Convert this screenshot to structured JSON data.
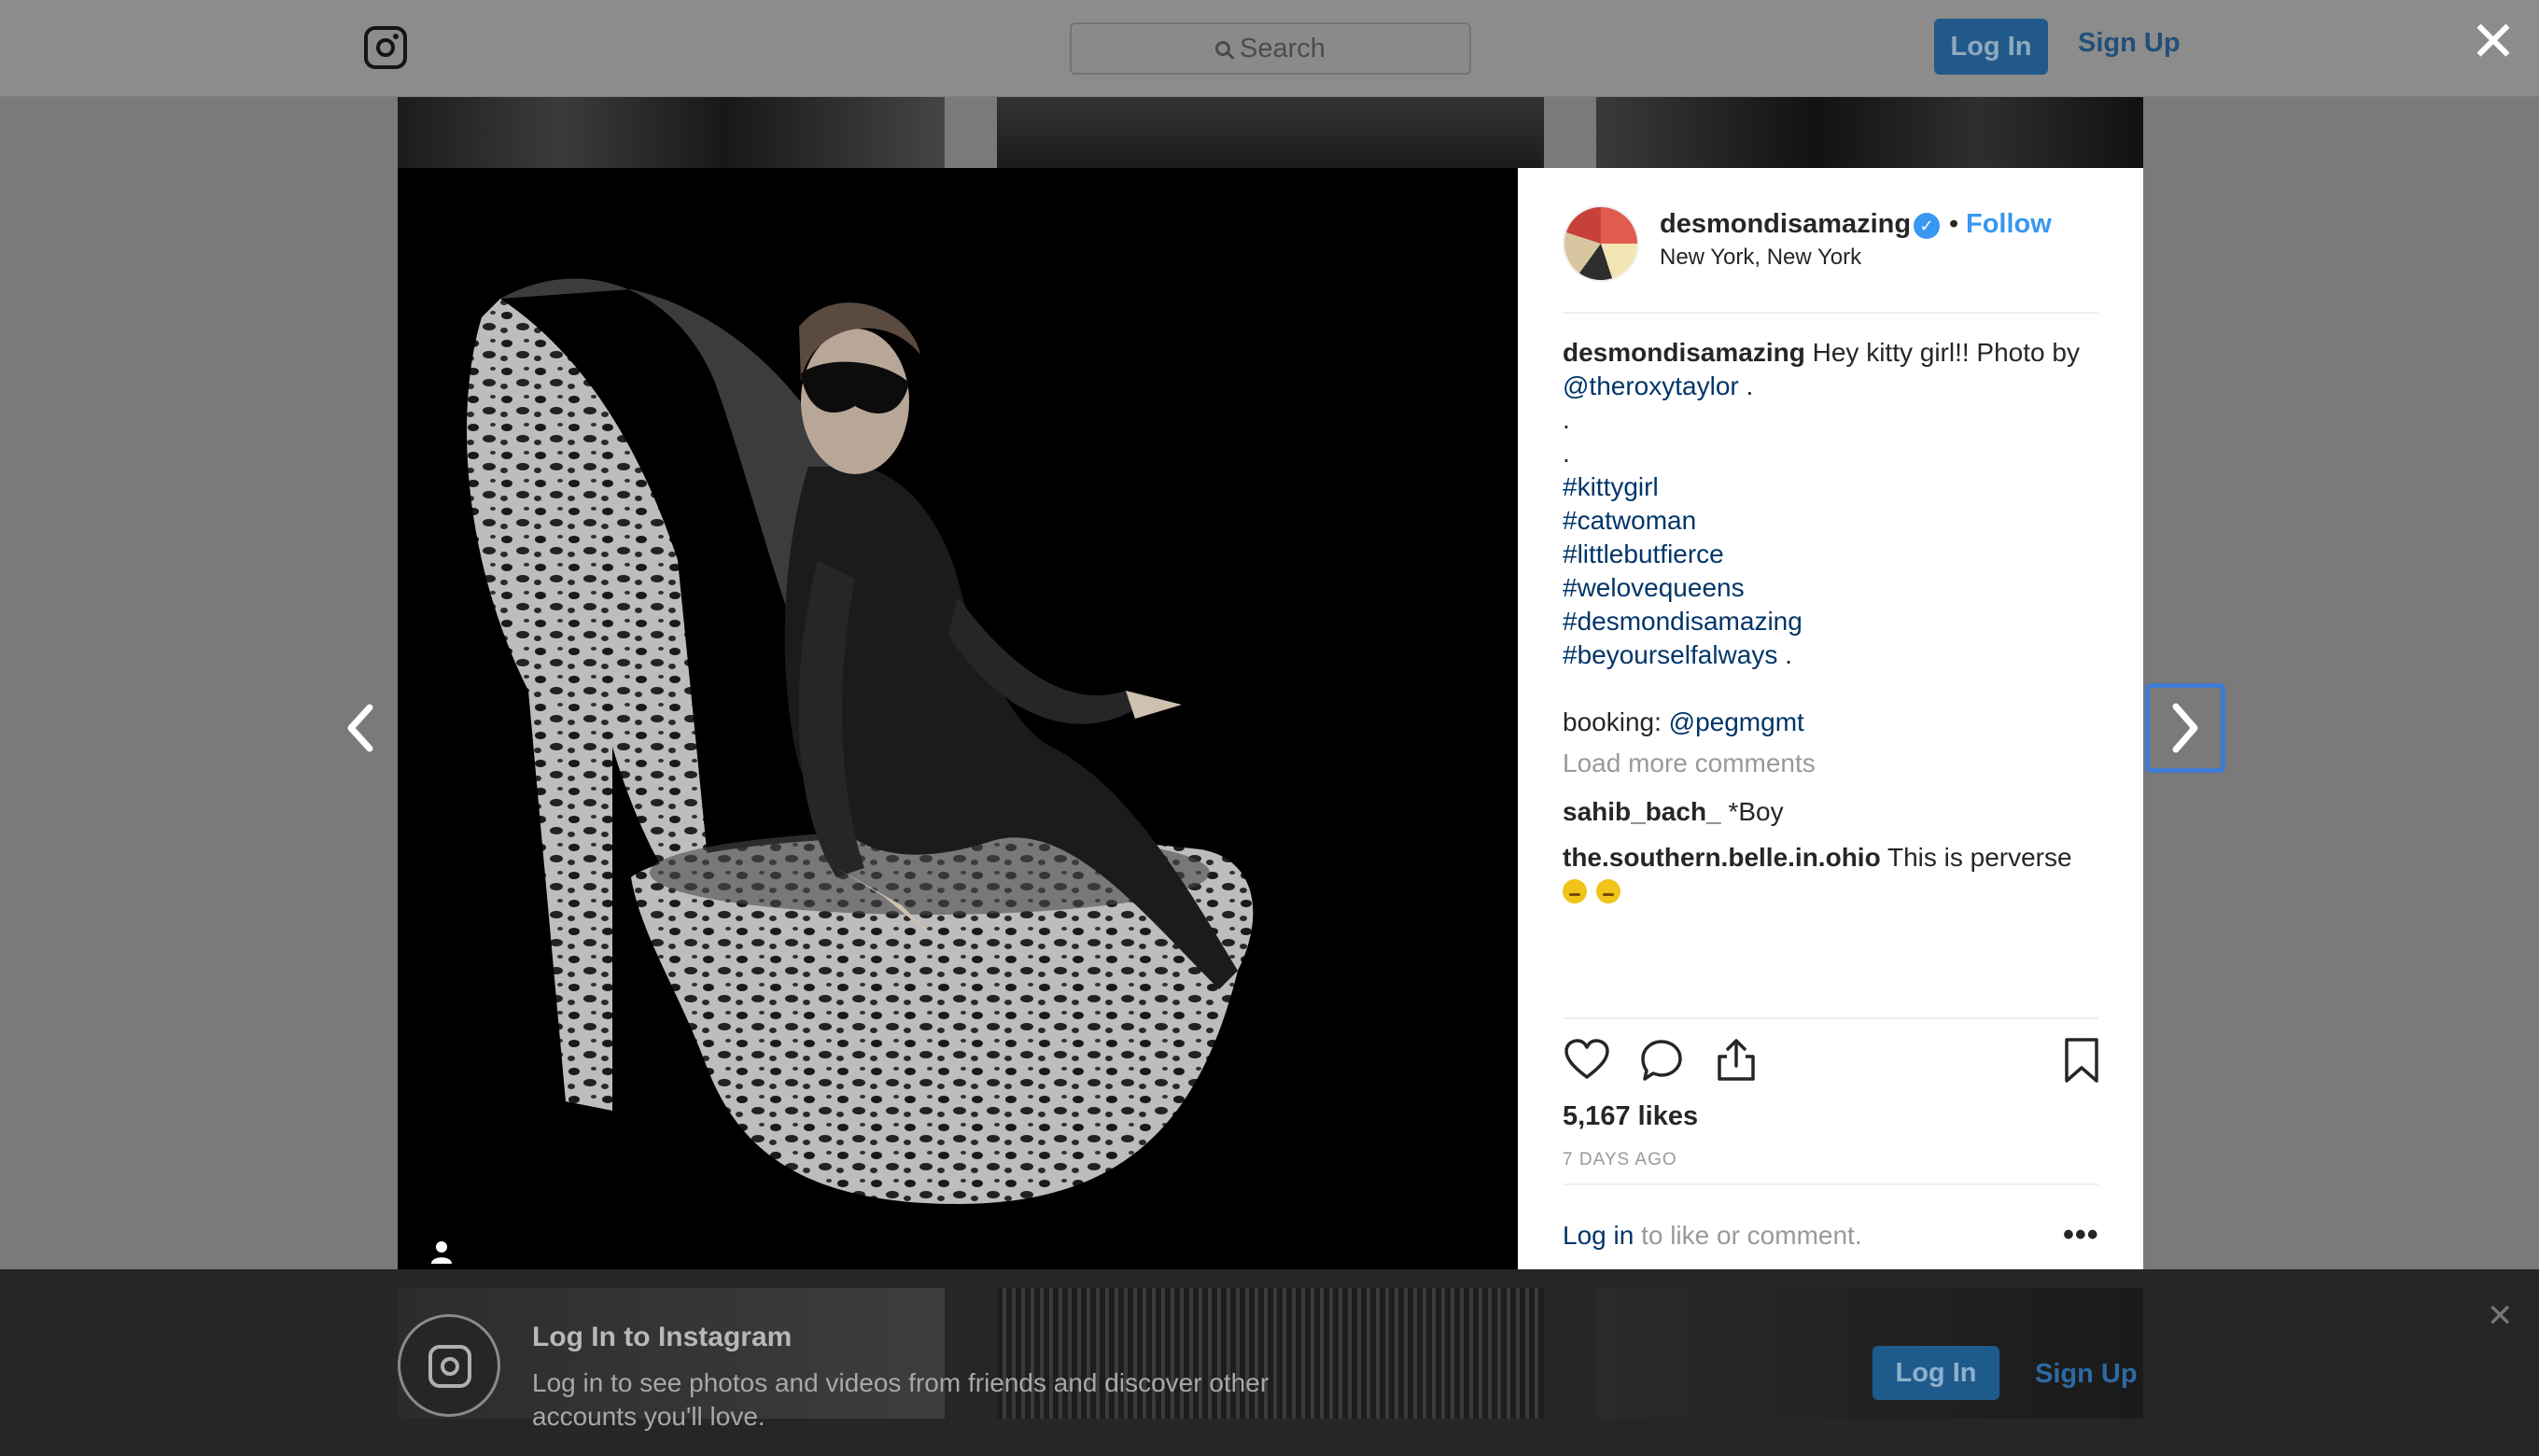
{
  "header": {
    "search_placeholder": "Search",
    "login_label": "Log In",
    "signup_label": "Sign Up"
  },
  "modal": {
    "close_icon": "close-icon",
    "prev_icon": "chevron-left-icon",
    "next_icon": "chevron-right-icon"
  },
  "post": {
    "username": "desmondisamazing",
    "verified": true,
    "separator": "•",
    "follow_label": "Follow",
    "location": "New York, New York",
    "caption_user": "desmondisamazing",
    "caption_text": "Hey kitty girl!! Photo by",
    "caption_mention": "@theroxytaylor",
    "caption_end": ".",
    "dot1": ".",
    "dot2": ".",
    "hashtags": [
      "#kittygirl",
      "#catwoman",
      "#littlebutfierce",
      "#welovequeens",
      "#desmondisamazing",
      "#beyourselfalways"
    ],
    "hashtag_trailing": ".",
    "booking_label": "booking:",
    "booking_mention": "@pegmgmt",
    "load_more": "Load more comments",
    "comments": [
      {
        "user": "sahib_bach_",
        "text": "*Boy"
      },
      {
        "user": "the.southern.belle.in.ohio",
        "text": "This is perverse"
      }
    ],
    "likes": "5,167 likes",
    "time_ago": "7 DAYS AGO",
    "login_link": "Log in",
    "login_suffix": "to like or comment.",
    "more_label": "•••"
  },
  "banner": {
    "title": "Log In to Instagram",
    "text": "Log in to see photos and videos from friends and discover other accounts you'll love.",
    "login_label": "Log In",
    "signup_label": "Sign Up",
    "close_label": "✕"
  },
  "colors": {
    "link": "#003569",
    "accent": "#3897f0",
    "muted": "#999999"
  }
}
